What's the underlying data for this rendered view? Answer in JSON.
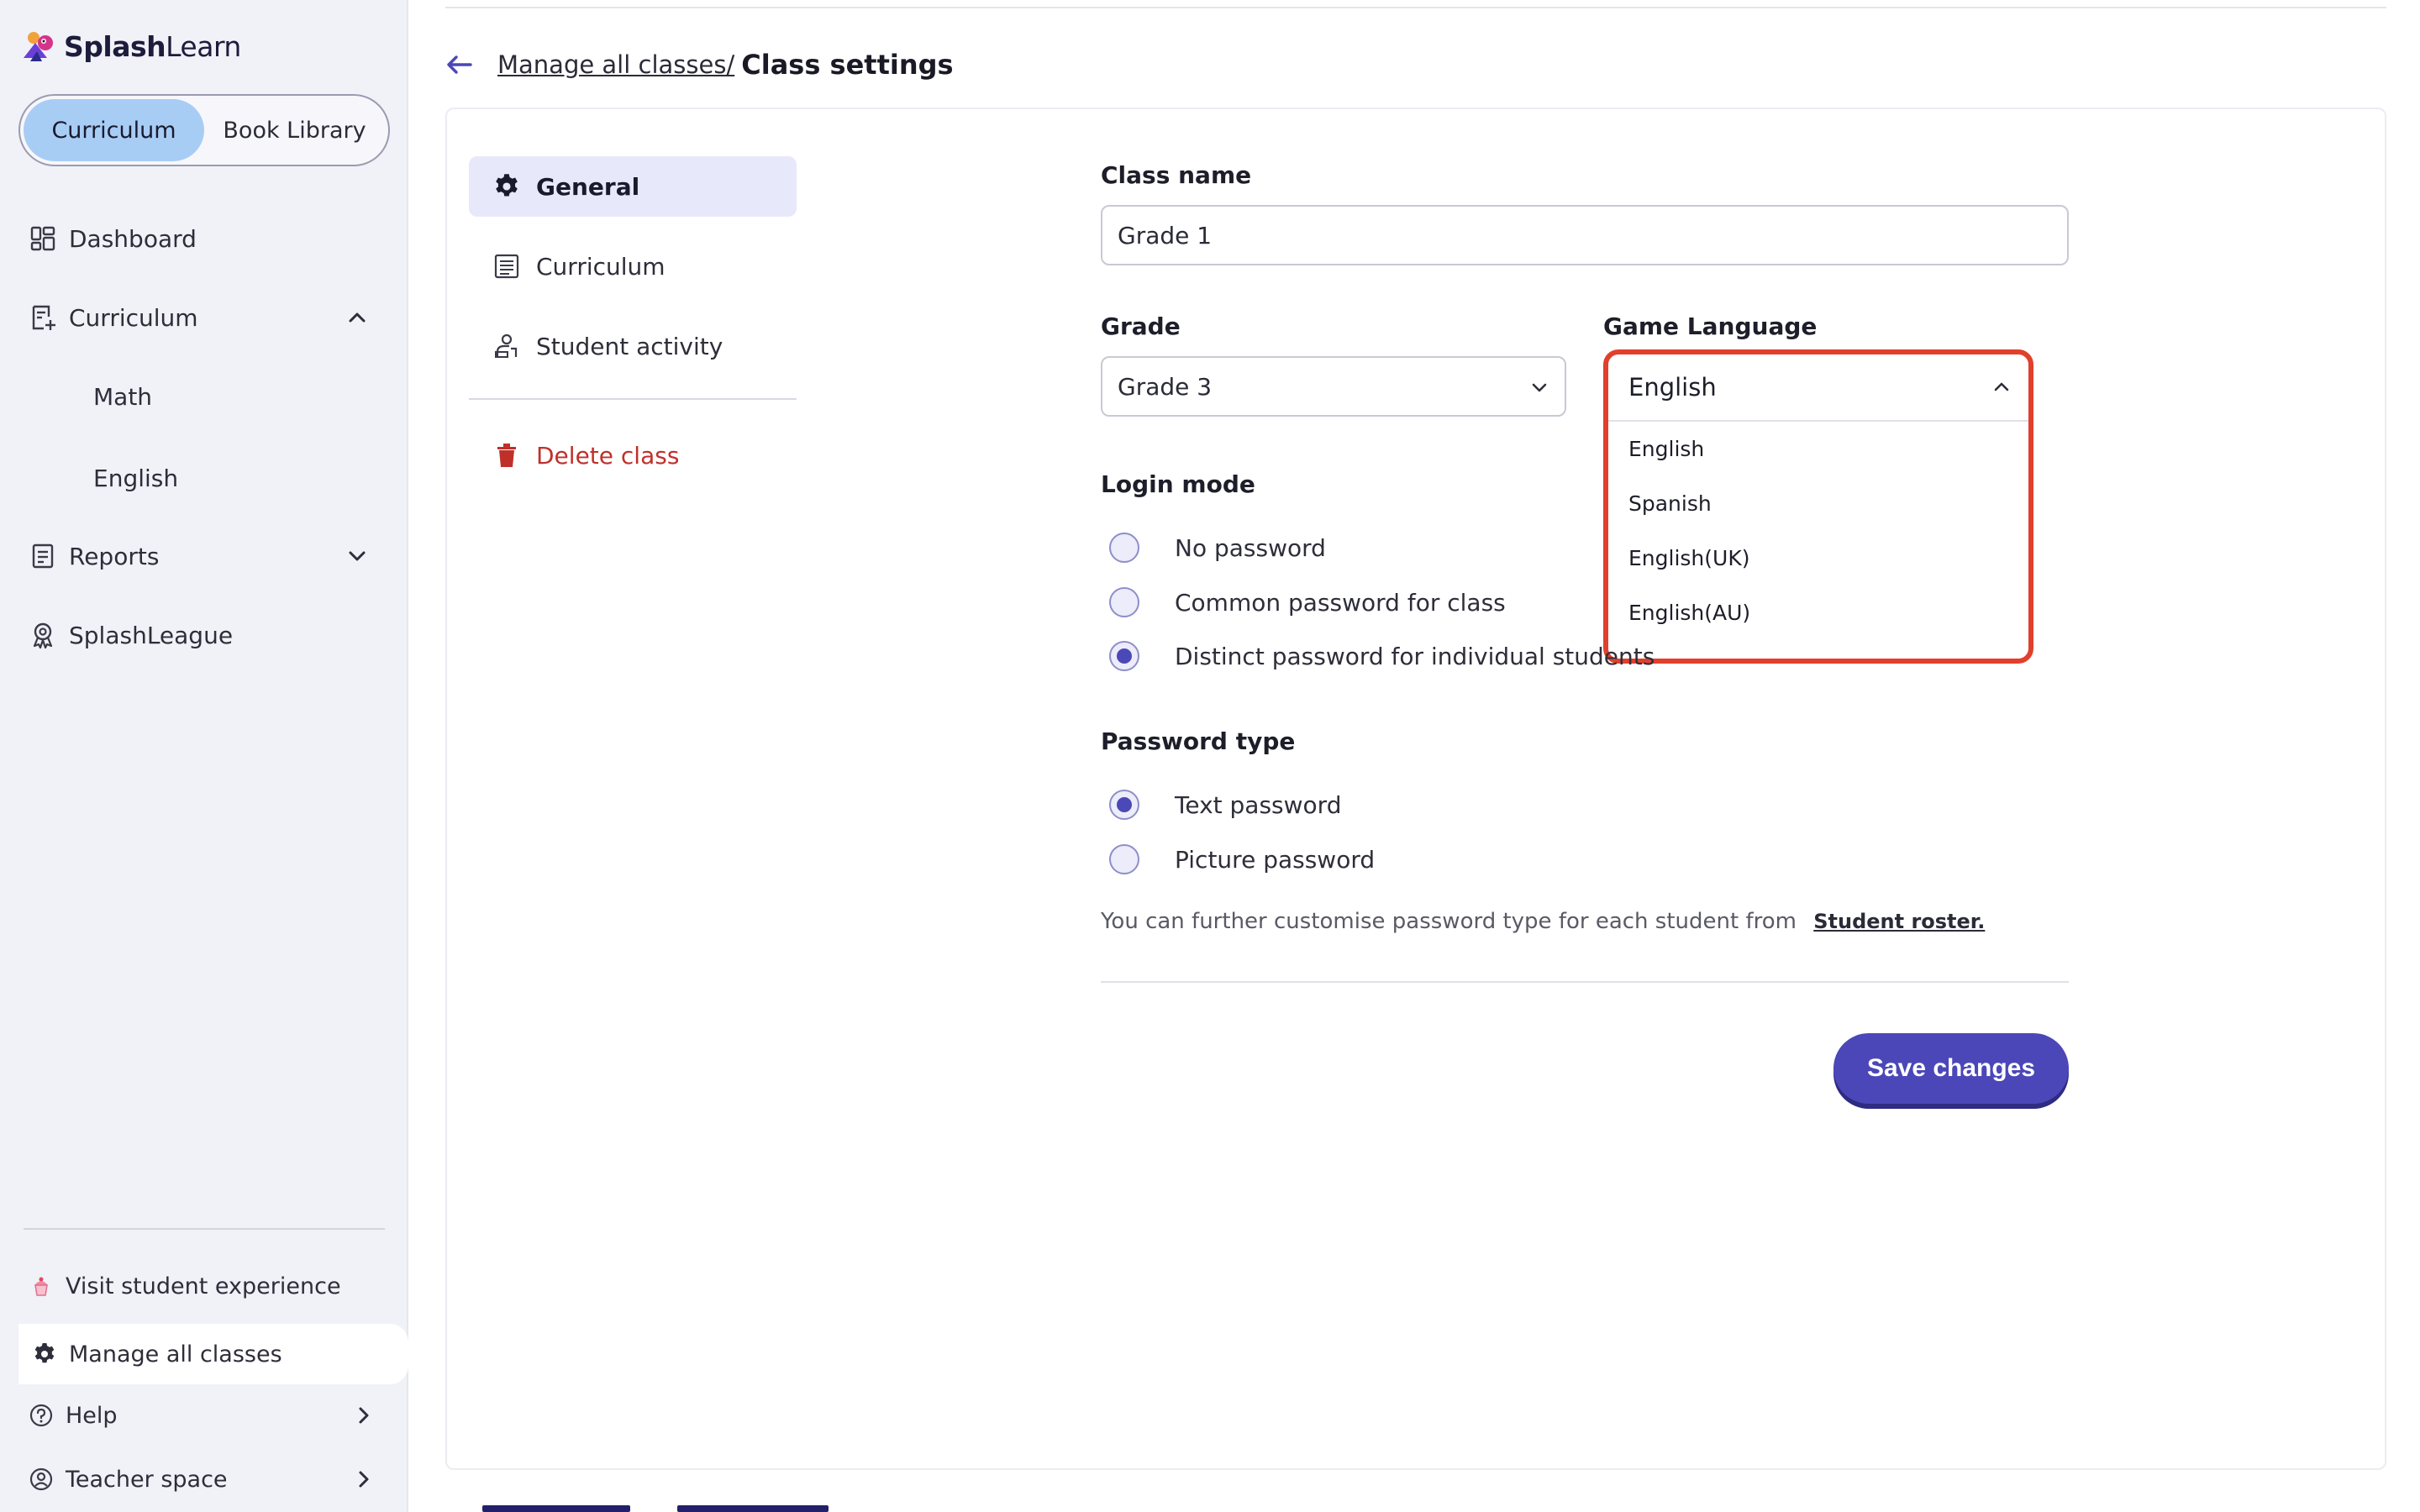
{
  "brand": {
    "name_bold": "Splash",
    "name_light": "Learn"
  },
  "sidebar": {
    "segments": [
      {
        "label": "Curriculum",
        "active": true
      },
      {
        "label": "Book Library",
        "active": false
      }
    ],
    "nav": [
      {
        "label": "Dashboard",
        "icon": "dashboard-icon"
      },
      {
        "label": "Curriculum",
        "icon": "curriculum-icon",
        "expanded": true
      },
      {
        "label": "Reports",
        "icon": "reports-icon",
        "expanded": false
      },
      {
        "label": "SplashLeague",
        "icon": "splashleague-icon"
      }
    ],
    "curriculum_sub": [
      "Math",
      "English"
    ],
    "bottom": [
      {
        "label": "Visit student experience",
        "icon": "cupcake-icon"
      },
      {
        "label": "Manage all classes",
        "icon": "gear-icon"
      },
      {
        "label": "Help",
        "icon": "help-icon"
      },
      {
        "label": "Teacher space",
        "icon": "teacher-icon"
      }
    ]
  },
  "breadcrumb": {
    "link": "Manage all classes/",
    "current": "Class settings"
  },
  "tabs": [
    {
      "label": "General",
      "icon": "gear-icon",
      "active": true
    },
    {
      "label": "Curriculum",
      "icon": "list-icon"
    },
    {
      "label": "Student activity",
      "icon": "student-activity-icon"
    },
    {
      "label": "Delete class",
      "icon": "trash-icon"
    }
  ],
  "form": {
    "class_name": {
      "label": "Class name",
      "value": "Grade 1"
    },
    "grade": {
      "label": "Grade",
      "value": "Grade 3"
    },
    "game_language": {
      "label": "Game Language",
      "value": "English",
      "options": [
        "English",
        "Spanish",
        "English(UK)",
        "English(AU)"
      ],
      "open": true
    },
    "login_mode": {
      "label": "Login mode",
      "options": [
        {
          "label": "No password",
          "checked": false
        },
        {
          "label": "Common password for class",
          "checked": false
        },
        {
          "label": "Distinct password for individual students",
          "checked": true
        }
      ]
    },
    "password_type": {
      "label": "Password type",
      "options": [
        {
          "label": "Text password",
          "checked": true
        },
        {
          "label": "Picture password",
          "checked": false
        }
      ]
    },
    "note": "You can further customise password type for each student from",
    "note_link": "Student roster.",
    "save_label": "Save changes"
  },
  "colors": {
    "accent": "#4b47b8",
    "danger": "#c0302b",
    "highlight": "#e0402c",
    "segment_active": "#a8cdf5"
  }
}
